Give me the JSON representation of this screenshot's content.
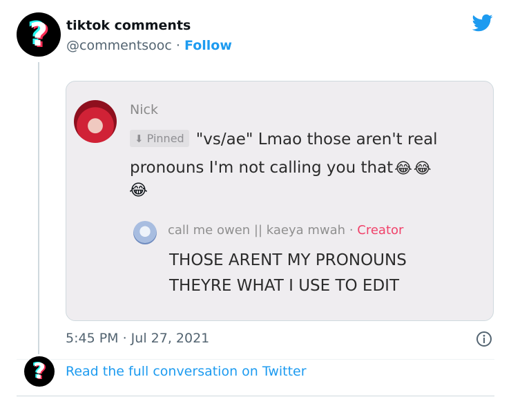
{
  "tweet": {
    "author_name": "tiktok comments",
    "author_handle": "@commentsooc",
    "separator": " · ",
    "follow_label": "Follow",
    "avatar_glyph": "?",
    "timestamp": "5:45 PM · Jul 27, 2021",
    "read_full_label": "Read the full conversation on Twitter"
  },
  "embedded_comment": {
    "commenter_name": "Nick",
    "pinned_icon": "⬇",
    "pinned_label": "Pinned",
    "comment_line1": "\"vs/ae\" Lmao those aren't real",
    "comment_line2": "pronouns I'm not calling you that",
    "emoji": "😂",
    "reply_author": "call me owen || kaeya mwah",
    "reply_separator": " · ",
    "reply_badge": "Creator",
    "reply_line1": "THOSE ARENT MY PRONOUNS",
    "reply_line2": "THEYRE WHAT I USE TO EDIT"
  },
  "icons": {
    "brand": "twitter-bird-icon",
    "info": "info-icon",
    "pin": "pin-icon"
  },
  "colors": {
    "link_blue": "#1d9bf0",
    "creator_pink": "#f0426a",
    "muted_text": "#536471"
  }
}
